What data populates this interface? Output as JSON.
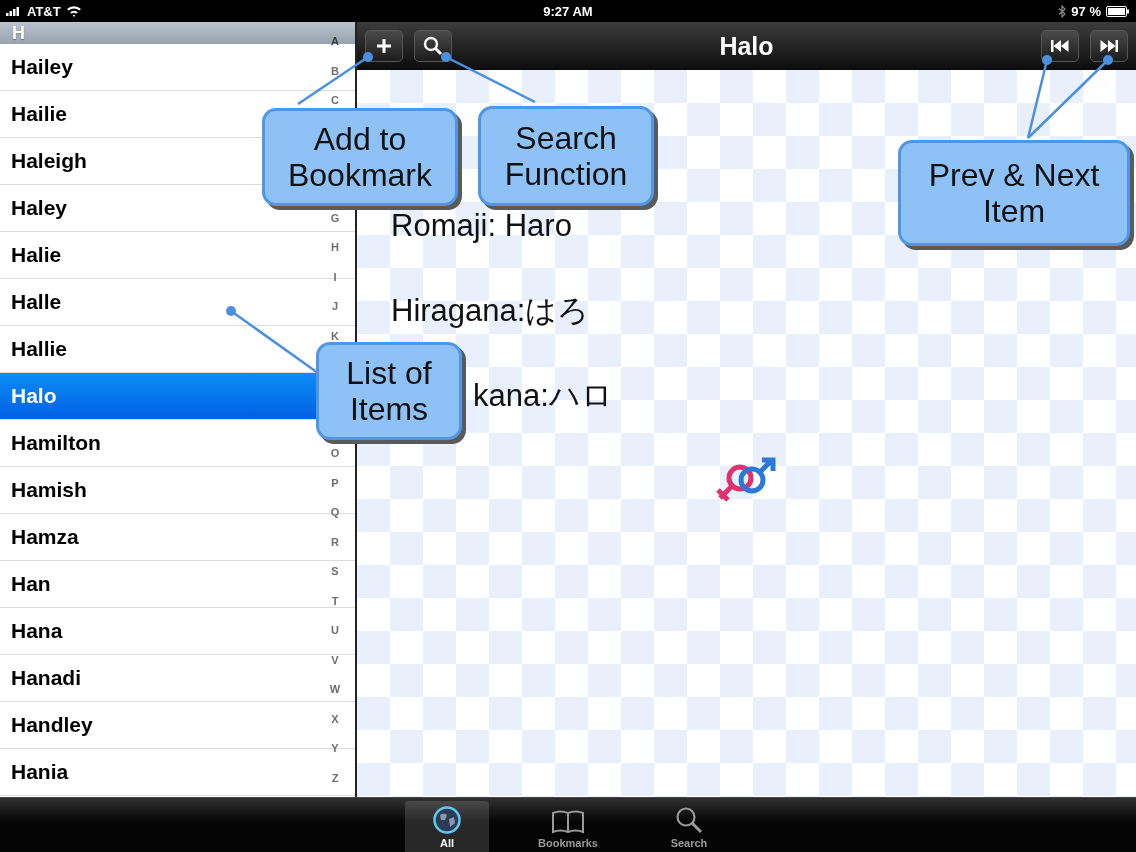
{
  "status_bar": {
    "carrier": "AT&T",
    "time": "9:27 AM",
    "battery": "97 %"
  },
  "list": {
    "section": "H",
    "items": [
      {
        "name": "Hailey",
        "selected": false
      },
      {
        "name": "Hailie",
        "selected": false
      },
      {
        "name": "Haleigh",
        "selected": false
      },
      {
        "name": "Haley",
        "selected": false
      },
      {
        "name": "Halie",
        "selected": false
      },
      {
        "name": "Halle",
        "selected": false
      },
      {
        "name": "Hallie",
        "selected": false
      },
      {
        "name": "Halo",
        "selected": true
      },
      {
        "name": "Hamilton",
        "selected": false
      },
      {
        "name": "Hamish",
        "selected": false
      },
      {
        "name": "Hamza",
        "selected": false
      },
      {
        "name": "Han",
        "selected": false
      },
      {
        "name": "Hana",
        "selected": false
      },
      {
        "name": "Hanadi",
        "selected": false
      },
      {
        "name": "Handley",
        "selected": false
      },
      {
        "name": "Hania",
        "selected": false
      }
    ],
    "index": [
      [
        "A",
        "B",
        "C"
      ],
      [
        "G",
        "H",
        "I",
        "J",
        "K"
      ],
      [
        "O",
        "P",
        "Q",
        "R",
        "S",
        "T",
        "U",
        "V",
        "W",
        "X",
        "Y",
        "Z"
      ]
    ]
  },
  "nav": {
    "title": "Halo"
  },
  "content": {
    "lines": [
      "Romaji: Haro",
      "Hiragana:はろ",
      "kana:ハロ"
    ]
  },
  "tabs": [
    {
      "label": "All",
      "selected": true
    },
    {
      "label": "Bookmarks",
      "selected": false
    },
    {
      "label": "Search",
      "selected": false
    }
  ],
  "callouts": [
    {
      "lines": [
        "Add to",
        "Bookmark"
      ]
    },
    {
      "lines": [
        "Search",
        "Function"
      ]
    },
    {
      "lines": [
        "Prev & Next",
        "Item"
      ]
    },
    {
      "lines": [
        "List of",
        "Items"
      ]
    }
  ]
}
